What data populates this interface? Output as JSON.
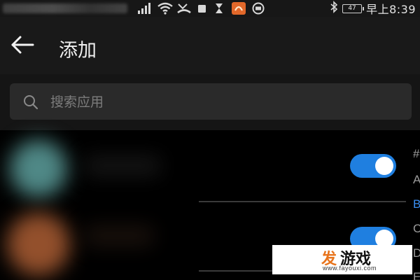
{
  "status_bar": {
    "clock": "早上8:39",
    "battery_level": "47",
    "icons": [
      "signal-icon",
      "wifi-icon",
      "missed-call-icon",
      "square-icon",
      "hourglass-icon",
      "app-notification-icon",
      "media-icon",
      "bluetooth-icon",
      "battery-icon"
    ]
  },
  "app_bar": {
    "title": "添加",
    "back_icon": "arrow-left-icon"
  },
  "search": {
    "placeholder": "搜索应用",
    "value": "",
    "icon": "search-icon"
  },
  "app_list": {
    "items": [
      {
        "toggle_on": true,
        "icon_color": "#4a7f7e",
        "accent": "#1f7fe0"
      },
      {
        "toggle_on": true,
        "icon_color": "#8a4a2a",
        "accent": "#1f7fe0"
      }
    ]
  },
  "alphabet_index": {
    "letters": [
      "#",
      "A",
      "B",
      "C",
      "D",
      "E"
    ],
    "active": "B"
  },
  "watermark": {
    "brand_mark": "发",
    "brand_name": "游戏",
    "url": "www.fayouxi.com"
  },
  "colors": {
    "toggle_on": "#1f7fe0",
    "index_active": "#3a8ef0",
    "app_bar_bg": "#191919",
    "search_bg": "#2a2a2a"
  }
}
